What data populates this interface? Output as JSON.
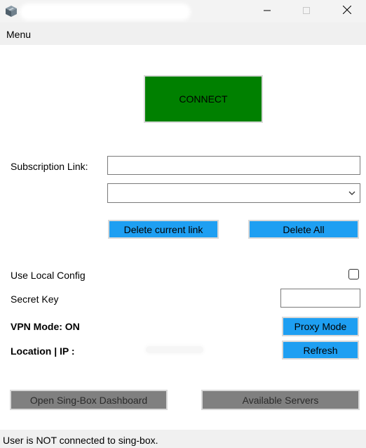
{
  "window": {
    "app_icon": "app-logo-icon",
    "controls": [
      "minimize-icon",
      "maximize-icon",
      "close-icon"
    ]
  },
  "menu": {
    "items": [
      {
        "label": "Menu"
      }
    ]
  },
  "connect": {
    "label": "CONNECT",
    "color": "#008000"
  },
  "subscription": {
    "label": "Subscription Link:",
    "input_value": "",
    "dropdown_value": "",
    "dropdown_icon": "chevron-down-icon"
  },
  "links": {
    "delete_current_label": "Delete current link",
    "delete_all_label": "Delete All"
  },
  "local_config": {
    "label": "Use Local Config",
    "checked": false
  },
  "secret_key": {
    "label": "Secret Key",
    "value": ""
  },
  "vpn_mode": {
    "label": "VPN Mode: ON",
    "button_label": "Proxy Mode"
  },
  "location": {
    "label": "Location | IP :",
    "button_label": "Refresh"
  },
  "bottom": {
    "dashboard_label": "Open Sing-Box Dashboard",
    "servers_label": "Available Servers"
  },
  "status": {
    "text": "User is NOT connected to sing-box."
  },
  "colors": {
    "accent_blue": "#1e9ff2",
    "connect_green": "#008000",
    "disabled_gray": "#808080"
  }
}
